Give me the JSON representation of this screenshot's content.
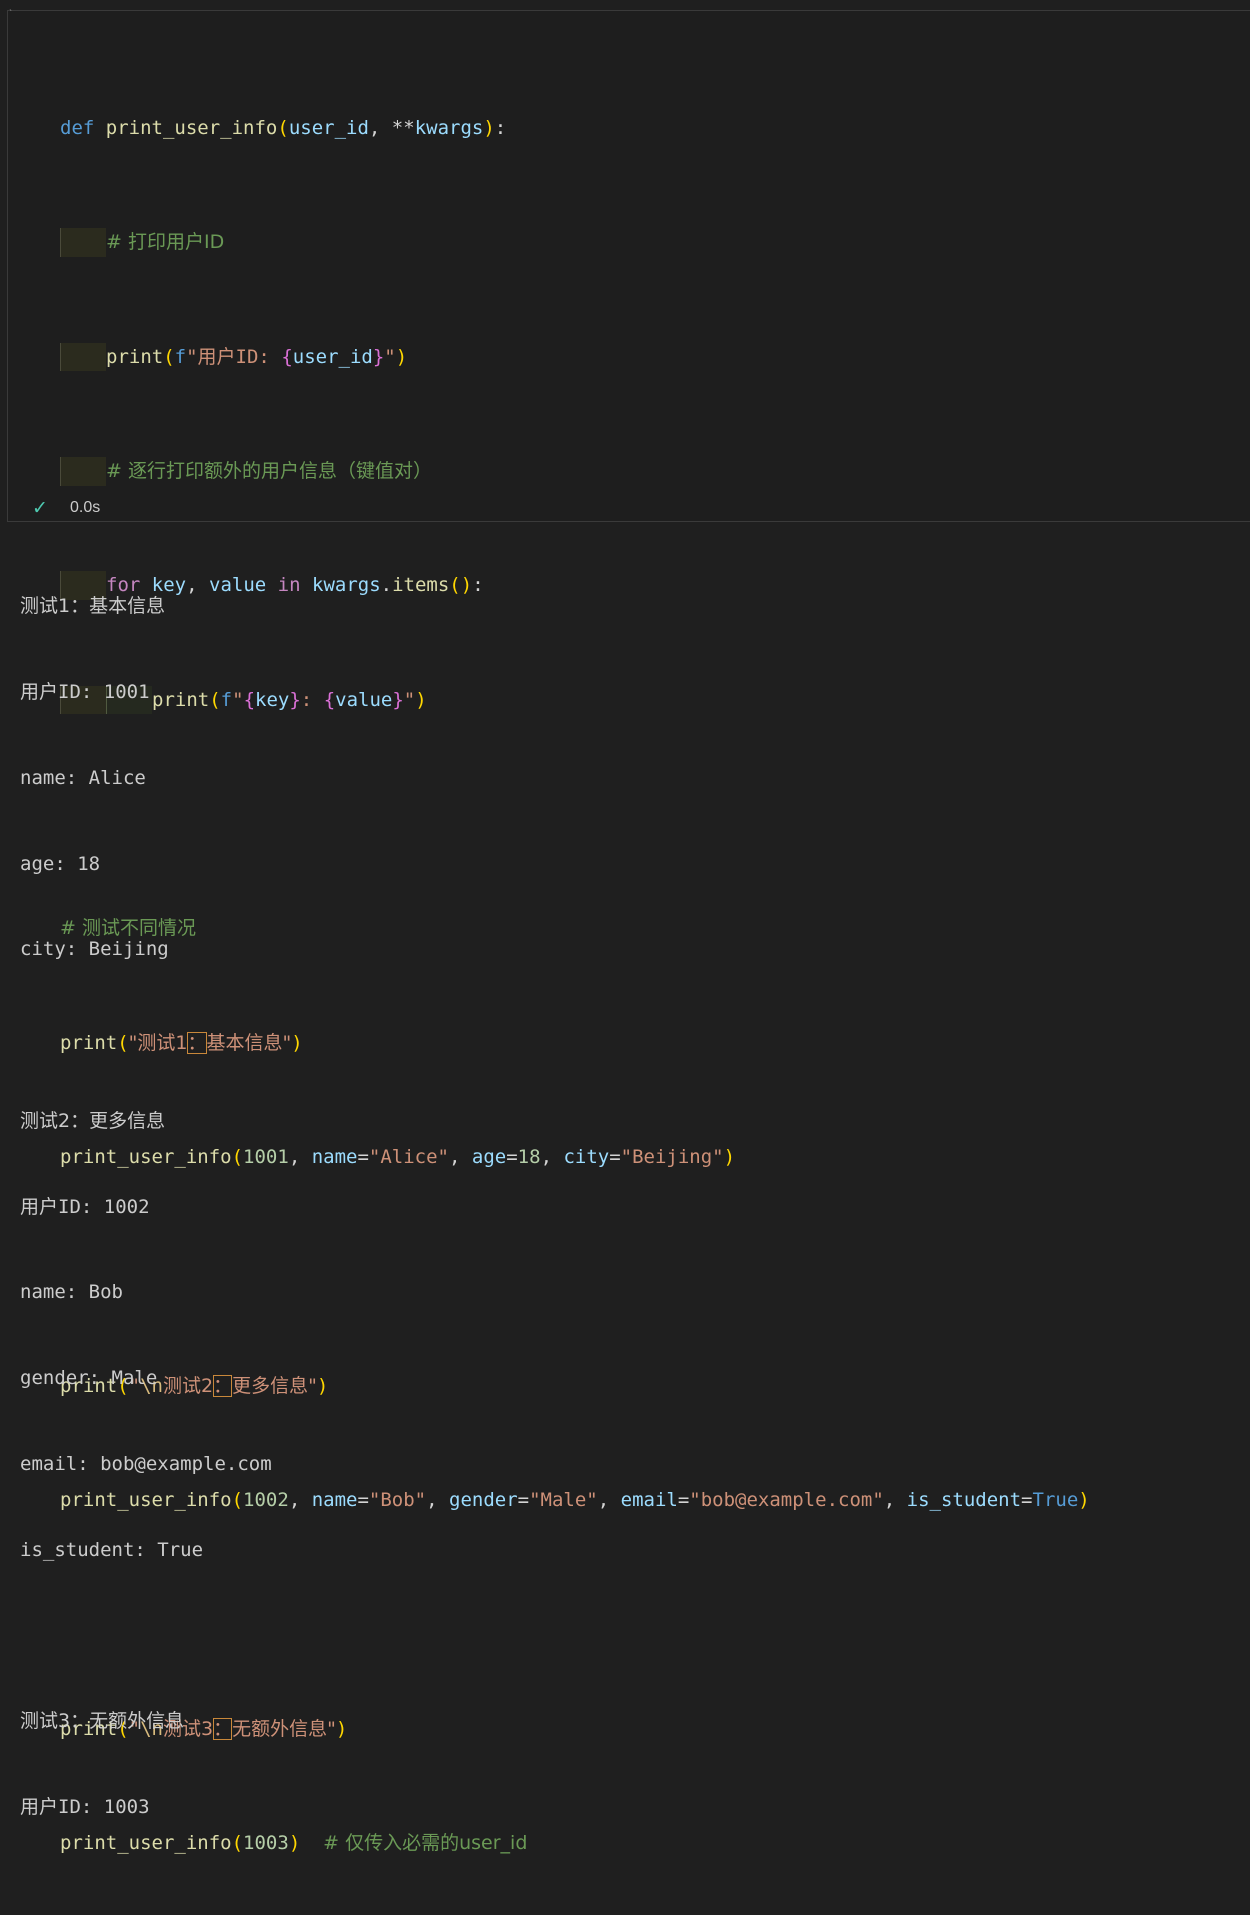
{
  "code": {
    "l1": {
      "def": "def",
      "fn": "print_user_info",
      "open": "(",
      "p1": "user_id",
      ", ": ", ",
      "star": "**",
      "p2": "kwargs",
      "close": ")",
      "colon": ":"
    },
    "l2": {
      "comment": "# 打印用户ID"
    },
    "l3": {
      "fn": "print",
      "open": "(",
      "f": "f",
      "q1": "\"用户ID: ",
      "b1": "{",
      "var": "user_id",
      "b2": "}",
      "q2": "\"",
      "close": ")"
    },
    "l4": {
      "comment": "# 逐行打印额外的用户信息（键值对）"
    },
    "l5": {
      "for": "for",
      "key": "key",
      ", ": ", ",
      "value": "value",
      "in": "in",
      "obj": "kwargs",
      ".": ".",
      "items": "items",
      "paren": "()",
      "colon": ":"
    },
    "l6": {
      "fn": "print",
      "open": "(",
      "f": "f",
      "q1": "\"",
      "b1": "{",
      "key": "key",
      "b2": "}",
      "sep": ": ",
      "b3": "{",
      "value": "value",
      "b4": "}",
      "q2": "\"",
      "close": ")"
    },
    "l8": {
      "comment": "# 测试不同情况"
    },
    "l9": {
      "fn": "print",
      "open": "(",
      "s1": "\"测试1",
      "colon": "：",
      "s2": "基本信息\"",
      "close": ")"
    },
    "l10": {
      "fn": "print_user_info",
      "open": "(",
      "num": "1001",
      ", ": ", ",
      "k1": "name",
      "eq": "=",
      "v1": "\"Alice\"",
      "k2": "age",
      "v2": "18",
      "k3": "city",
      "v3": "\"Beijing\"",
      "close": ")"
    },
    "l12": {
      "fn": "print",
      "open": "(",
      "s1": "\"",
      "esc": "\\n",
      "s1b": "测试2",
      "colon": "：",
      "s2": "更多信息\"",
      "close": ")"
    },
    "l13": {
      "fn": "print_user_info",
      "open": "(",
      "num": "1002",
      ", ": ", ",
      "k1": "name",
      "eq": "=",
      "v1": "\"Bob\"",
      "k2": "gender",
      "v2": "\"Male\"",
      "k3": "email",
      "v3": "\"bob@example.com\"",
      "k4": "is_student",
      "v4": "True",
      "close": ")"
    },
    "l15": {
      "fn": "print",
      "open": "(",
      "s1": "\"",
      "esc": "\\n",
      "s1b": "测试3",
      "colon": "：",
      "s2": "无额外信息\"",
      "close": ")"
    },
    "l16": {
      "fn": "print_user_info",
      "open": "(",
      "num": "1003",
      "close": ")",
      "comment": "# 仅传入必需的user_id"
    }
  },
  "status": {
    "icon": "check-icon",
    "time": "0.0s"
  },
  "output": {
    "block1": [
      "测试1：基本信息",
      "用户ID: 1001",
      "name: Alice",
      "age: 18",
      "city: Beijing"
    ],
    "block2": [
      "测试2：更多信息",
      "用户ID: 1002",
      "name: Bob",
      "gender: Male",
      "email: bob@example.com",
      "is_student: True"
    ],
    "block3": [
      "测试3：无额外信息",
      "用户ID: 1003"
    ]
  }
}
